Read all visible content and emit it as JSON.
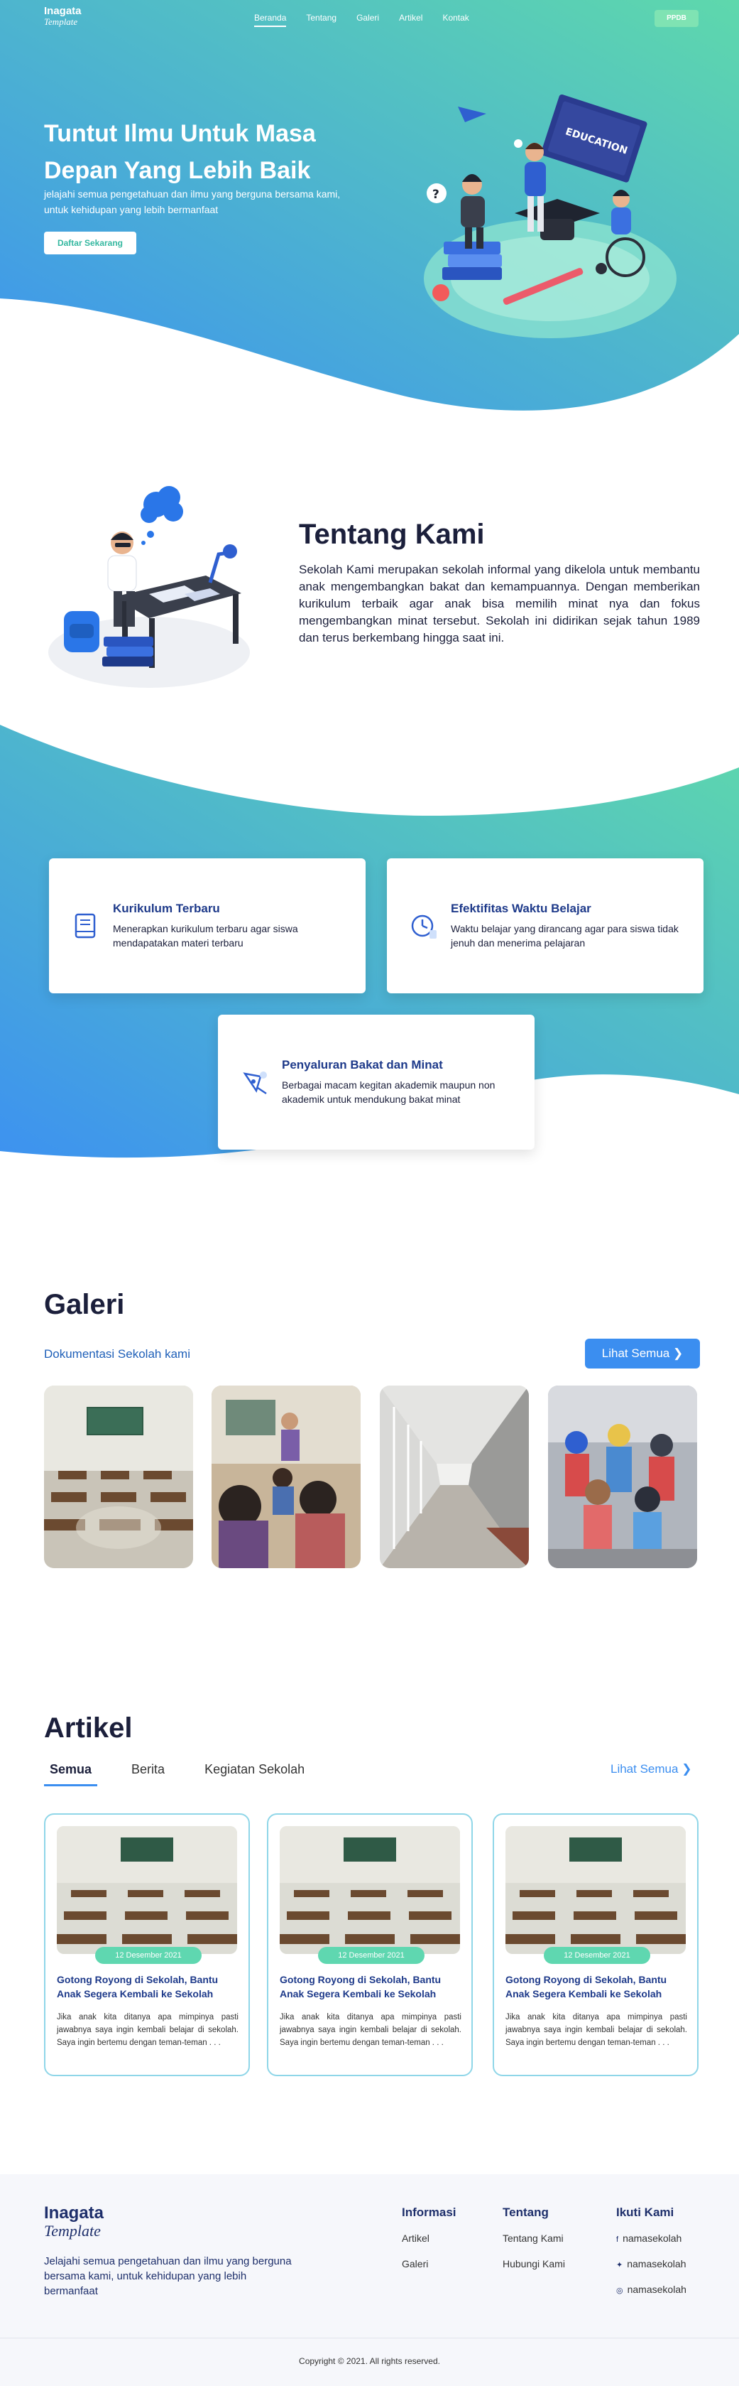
{
  "colors": {
    "teal": "#5fd7b0",
    "blue": "#3b8ef0",
    "navy": "#1e2f6b"
  },
  "nav": {
    "logo_main": "Inagata",
    "logo_script": "Template",
    "items": [
      "Beranda",
      "Tentang",
      "Galeri",
      "Artikel",
      "Kontak"
    ],
    "active": "Beranda",
    "cta": "PPDB"
  },
  "hero": {
    "title": "Tuntut Ilmu Untuk Masa Depan Yang Lebih Baik",
    "subtitle": "jelajahi semua pengetahuan dan ilmu yang berguna bersama kami, untuk kehidupan yang lebih bermanfaat",
    "button": "Daftar Sekarang",
    "board_text": "EDUCATION"
  },
  "about": {
    "title": "Tentang Kami",
    "text": "Sekolah Kami merupakan sekolah informal yang dikelola untuk membantu anak mengembangkan bakat dan kemampuannya. Dengan memberikan kurikulum terbaik agar anak bisa memilih minat nya dan fokus mengembangkan minat tersebut. Sekolah ini didirikan sejak tahun 1989 dan terus berkembang hingga saat ini."
  },
  "features": [
    {
      "icon": "book-icon",
      "title": "Kurikulum Terbaru",
      "text": "Menerapkan kurikulum terbaru agar siswa mendapatakan materi terbaru"
    },
    {
      "icon": "clock-icon",
      "title": "Efektifitas Waktu Belajar",
      "text": "Waktu belajar yang dirancang agar para siswa tidak jenuh dan menerima pelajaran"
    },
    {
      "icon": "talent-icon",
      "title": "Penyaluran Bakat dan Minat",
      "text": "Berbagai macam kegitan akademik maupun non akademik untuk mendukung bakat minat"
    }
  ],
  "gallery": {
    "title": "Galeri",
    "subtitle": "Dokumentasi Sekolah kami",
    "button": "Lihat Semua",
    "photos": [
      "classroom-photo",
      "students-photo",
      "corridor-photo",
      "kids-photo"
    ]
  },
  "articles": {
    "title": "Artikel",
    "tabs": [
      "Semua",
      "Berita",
      "Kegiatan Sekolah"
    ],
    "active_tab": "Semua",
    "see_all": "Lihat Semua",
    "items": [
      {
        "date": "12 Desember 2021",
        "title": "Gotong Royong di Sekolah, Bantu Anak Segera Kembali ke Sekolah",
        "excerpt": "Jika anak kita ditanya apa mimpinya pasti jawabnya saya ingin kembali belajar di sekolah. Saya ingin bertemu dengan teman-teman . . ."
      },
      {
        "date": "12 Desember 2021",
        "title": "Gotong Royong di Sekolah, Bantu Anak Segera Kembali ke Sekolah",
        "excerpt": "Jika anak kita ditanya apa mimpinya pasti jawabnya saya ingin kembali belajar di sekolah. Saya ingin bertemu dengan teman-teman . . ."
      },
      {
        "date": "12 Desember 2021",
        "title": "Gotong Royong di Sekolah, Bantu Anak Segera Kembali ke Sekolah",
        "excerpt": "Jika anak kita ditanya apa mimpinya pasti jawabnya saya ingin kembali belajar di sekolah. Saya ingin bertemu dengan teman-teman . . ."
      }
    ]
  },
  "footer": {
    "logo_main": "Inagata",
    "logo_script": "Template",
    "description": "Jelajahi semua pengetahuan dan ilmu yang berguna bersama kami, untuk kehidupan yang lebih bermanfaat",
    "informasi": {
      "title": "Informasi",
      "links": [
        "Artikel",
        "Galeri"
      ]
    },
    "tentang": {
      "title": "Tentang",
      "links": [
        "Tentang Kami",
        "Hubungi Kami"
      ]
    },
    "social": {
      "title": "Ikuti Kami",
      "links": [
        "namasekolah",
        "namasekolah",
        "namasekolah"
      ],
      "icons": [
        "facebook-icon",
        "twitter-icon",
        "instagram-icon"
      ]
    },
    "copyright": "Copyright © 2021. All rights reserved."
  }
}
